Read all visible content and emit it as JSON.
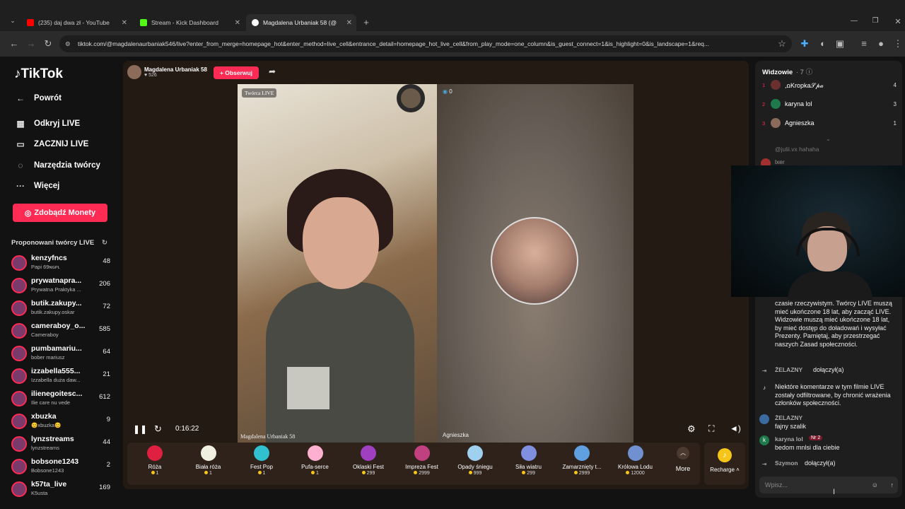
{
  "browser": {
    "tabs": [
      {
        "title": "(235) daj dwa zł - YouTube",
        "color": "#ff0000"
      },
      {
        "title": "Stream - Kick Dashboard",
        "color": "#53fc18"
      },
      {
        "title": "Magdalena Urbaniak 58 (@",
        "color": "#ffffff"
      }
    ],
    "url": "tiktok.com/@magdalenaurbaniak546/live?enter_from_merge=homepage_hot&enter_method=live_cell&entrance_detail=homepage_hot_live_cell&from_play_mode=one_column&is_guest_connect=1&is_highlight=0&is_landscape=1&req..."
  },
  "sidebar": {
    "logo": "TikTok",
    "back": "Powrót",
    "items": [
      {
        "label": "Odkryj LIVE",
        "icon": "calendar-icon"
      },
      {
        "label": "ZACZNIJ LIVE",
        "icon": "video-camera-icon"
      },
      {
        "label": "Narzędzia twórcy",
        "icon": "lightbulb-icon"
      },
      {
        "label": "Więcej",
        "icon": "more-dots-icon"
      }
    ],
    "coins_button": "Zdobądź Monety",
    "suggested_title": "Proponowani twórcy LIVE",
    "creators": [
      {
        "name": "kenzyfncs",
        "sub": "Papi 69ɴɢᴘʟ",
        "count": "48"
      },
      {
        "name": "prywatnapra...",
        "sub": "Prywatna Praktyka ...",
        "count": "206"
      },
      {
        "name": "butik.zakupy...",
        "sub": "butik.zakupy.oskar",
        "count": "72"
      },
      {
        "name": "cameraboy_o...",
        "sub": "Cameraboy",
        "count": "585"
      },
      {
        "name": "pumbamariu...",
        "sub": "bober mariusz",
        "count": "64"
      },
      {
        "name": "izzabella555...",
        "sub": "Izzabella duża daw...",
        "count": "21"
      },
      {
        "name": "ilienegoitesc...",
        "sub": "Ilie care nu vede",
        "count": "612"
      },
      {
        "name": "xbuzka",
        "sub": "😊xbuzka😊",
        "count": "9"
      },
      {
        "name": "lynzstreams",
        "sub": "lynzstreams",
        "count": "44"
      },
      {
        "name": "bobsone1243",
        "sub": "Bobsone1243",
        "count": "2"
      },
      {
        "name": "k57ta_live",
        "sub": "K5usta",
        "count": "169"
      }
    ]
  },
  "stream": {
    "host_name": "Magdalena Urbaniak 58",
    "host_likes": "♥ 526",
    "follow_label": "+ Obserwuj",
    "creator_badge": "Twórca LIVE",
    "guest_score": "0",
    "left_name": "Magdalena Urbaniak 58",
    "right_name": "Agnieszka",
    "time": "0:16:22"
  },
  "gifts": [
    {
      "name": "Róża",
      "price": "1",
      "color": "#e02040"
    },
    {
      "name": "Biała róża",
      "price": "1",
      "color": "#f0f0e0"
    },
    {
      "name": "Fest Pop",
      "price": "1",
      "color": "#30c0d0"
    },
    {
      "name": "Pufa-serce",
      "price": "1",
      "color": "#ffb0d0"
    },
    {
      "name": "Oklaski Fest",
      "price": "299",
      "color": "#a040c0"
    },
    {
      "name": "Impreza Fest",
      "price": "2999",
      "color": "#c04080"
    },
    {
      "name": "Opady śniegu",
      "price": "999",
      "color": "#a0d0f0"
    },
    {
      "name": "Siła wiatru",
      "price": "299",
      "color": "#8090e0"
    },
    {
      "name": "Zamarznięty t...",
      "price": "2999",
      "color": "#60a0e0"
    },
    {
      "name": "Królowa Lodu",
      "price": "12000",
      "color": "#7090d0"
    }
  ],
  "more_label": "More",
  "recharge_label": "Recharge",
  "viewers": {
    "title": "Widzowie",
    "count": "· 7",
    "list": [
      {
        "rank": "1",
        "name": ",ꭥKropka𝒮𝓅𝒶",
        "count": "4",
        "color": "#6a3030"
      },
      {
        "rank": "2",
        "name": "karyna lol",
        "count": "3",
        "color": "#1e7a4a"
      },
      {
        "rank": "3",
        "name": "Agnieszka",
        "count": "1",
        "color": "#8a6a5a"
      }
    ]
  },
  "chat": {
    "faded_1": "@julii.vx hahaha",
    "faded_2": "lxer",
    "notice": "czasie rzeczywistym. Twórcy LIVE muszą mieć ukończone 18 lat, aby zacząć LIVE. Widzowie muszą mieć ukończone 18 lat, by mieć dostęp do doładowań i wysyłać Prezenty. Pamiętaj, aby przestrzegać naszych Zasad społeczności.",
    "join1_user": "ŻELAZNY",
    "join1_text": "dołączył(a)",
    "filter_note": "Niektóre komentarze w tym filmie LIVE zostały odfiltrowane, by chronić wrażenia członków społeczności.",
    "msg1_user": "ŻELAZNY",
    "msg1_text": "fajny szalik",
    "msg2_user": "karyna lol",
    "msg2_badge": "Nr 2",
    "msg2_text": "bedom mnlsi dla ciebie",
    "join2_user": "Szymon",
    "join2_text": "dołączył(a)",
    "input_placeholder": "Wpisz..."
  }
}
